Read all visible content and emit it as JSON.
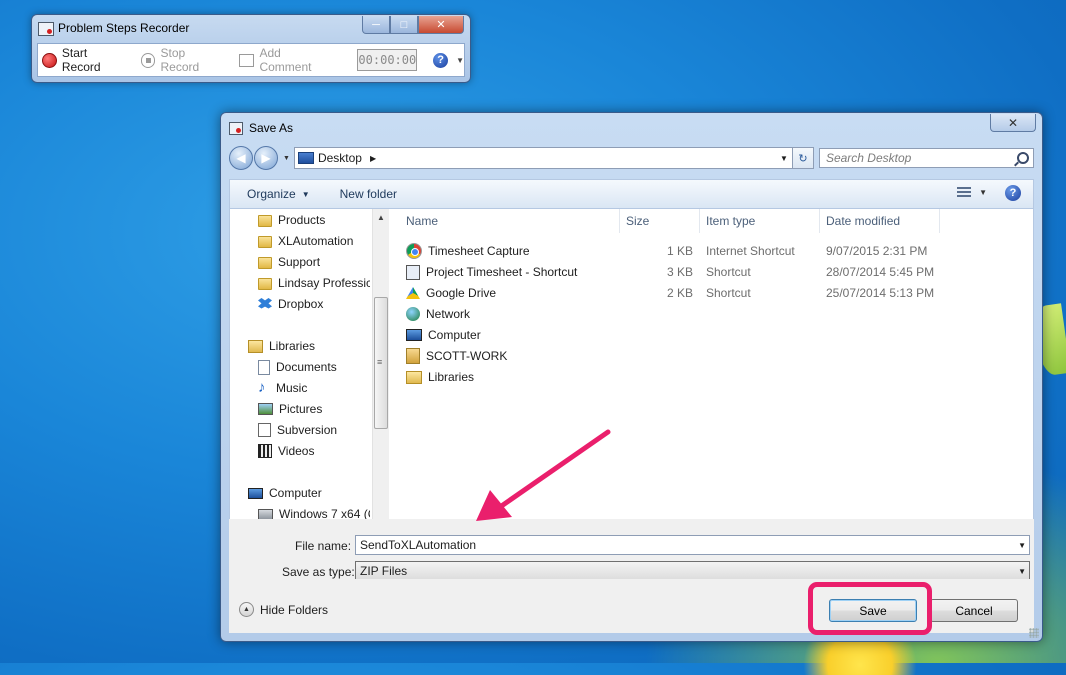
{
  "psr": {
    "title": "Problem Steps Recorder",
    "start_record": "Start Record",
    "stop_record": "Stop Record",
    "add_comment": "Add Comment",
    "timer": "00:00:00",
    "help": "?",
    "min": "─",
    "max": "□",
    "close": "✕"
  },
  "dialog": {
    "title": "Save As",
    "close": "✕",
    "address": "Desktop",
    "search_placeholder": "Search Desktop",
    "organize": "Organize",
    "new_folder": "New folder",
    "help": "?",
    "nav": [
      {
        "label": "Products",
        "icon": "folder-icon"
      },
      {
        "label": "XLAutomation",
        "icon": "folder-icon"
      },
      {
        "label": "Support",
        "icon": "folder-icon"
      },
      {
        "label": "Lindsay Professic",
        "icon": "folder-icon"
      },
      {
        "label": "Dropbox",
        "icon": "dropbox-icon"
      },
      {
        "label": "Libraries",
        "icon": "libraries-icon"
      },
      {
        "label": "Documents",
        "icon": "documents-icon"
      },
      {
        "label": "Music",
        "icon": "music-icon"
      },
      {
        "label": "Pictures",
        "icon": "pictures-icon"
      },
      {
        "label": "Subversion",
        "icon": "subversion-icon"
      },
      {
        "label": "Videos",
        "icon": "videos-icon"
      },
      {
        "label": "Computer",
        "icon": "computer-icon"
      },
      {
        "label": "Windows 7 x64 (C",
        "icon": "drive-icon"
      }
    ],
    "columns": {
      "name": "Name",
      "size": "Size",
      "type": "Item type",
      "date": "Date modified"
    },
    "files": [
      {
        "name": "Timesheet Capture",
        "size": "1 KB",
        "type": "Internet Shortcut",
        "date": "9/07/2015 2:31 PM"
      },
      {
        "name": "Project Timesheet - Shortcut",
        "size": "3 KB",
        "type": "Shortcut",
        "date": "28/07/2014 5:45 PM"
      },
      {
        "name": "Google Drive",
        "size": "2 KB",
        "type": "Shortcut",
        "date": "25/07/2014 5:13 PM"
      },
      {
        "name": "Network",
        "size": "",
        "type": "",
        "date": ""
      },
      {
        "name": "Computer",
        "size": "",
        "type": "",
        "date": ""
      },
      {
        "name": "SCOTT-WORK",
        "size": "",
        "type": "",
        "date": ""
      },
      {
        "name": "Libraries",
        "size": "",
        "type": "",
        "date": ""
      }
    ],
    "file_name_label": "File name:",
    "file_name_value": "SendToXLAutomation",
    "save_type_label": "Save as type:",
    "save_type_value": "ZIP Files",
    "hide_folders": "Hide Folders",
    "save": "Save",
    "cancel": "Cancel"
  },
  "annotation_color": "#ea1f6c"
}
